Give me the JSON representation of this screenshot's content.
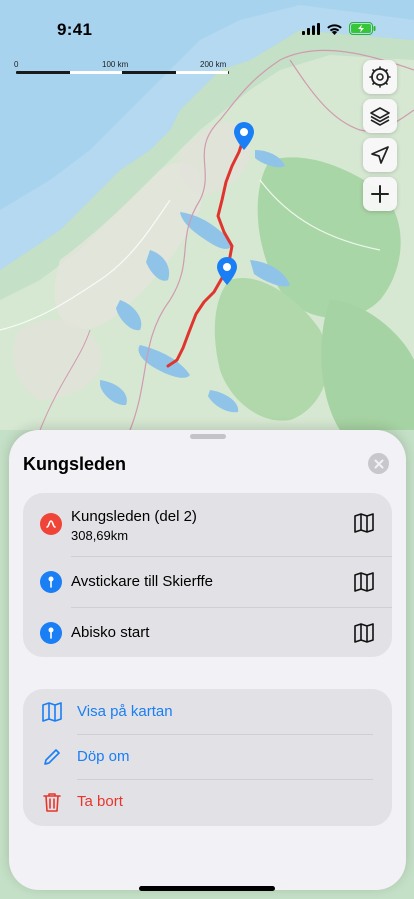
{
  "status_bar": {
    "time": "9:41"
  },
  "scale": {
    "label_0": "0",
    "label_100": "100 km",
    "label_200": "200 km"
  },
  "map_controls": [
    "clock-settings-icon",
    "layers-icon",
    "location-arrow-icon",
    "plus-icon"
  ],
  "sheet": {
    "title": "Kungsleden",
    "items": [
      {
        "title": "Kungsleden (del 2)",
        "subtitle": "308,69km",
        "type": "route",
        "color": "#f04438"
      },
      {
        "title": "Avstickare till Skierffe",
        "type": "waypoint",
        "color": "#1a7ef5"
      },
      {
        "title": "Abisko start",
        "type": "waypoint",
        "color": "#1a7ef5"
      }
    ],
    "actions": [
      {
        "label": "Visa på kartan",
        "icon": "map-icon",
        "color": "#1a7ef5"
      },
      {
        "label": "Döp om",
        "icon": "pencil-icon",
        "color": "#1a7ef5"
      },
      {
        "label": "Ta bort",
        "icon": "trash-icon",
        "color": "#e8352c"
      }
    ]
  },
  "colors": {
    "route": "#e0352f",
    "pin": "#1a7ef5",
    "accent": "#1a7ef5",
    "destructive": "#e8352c"
  }
}
